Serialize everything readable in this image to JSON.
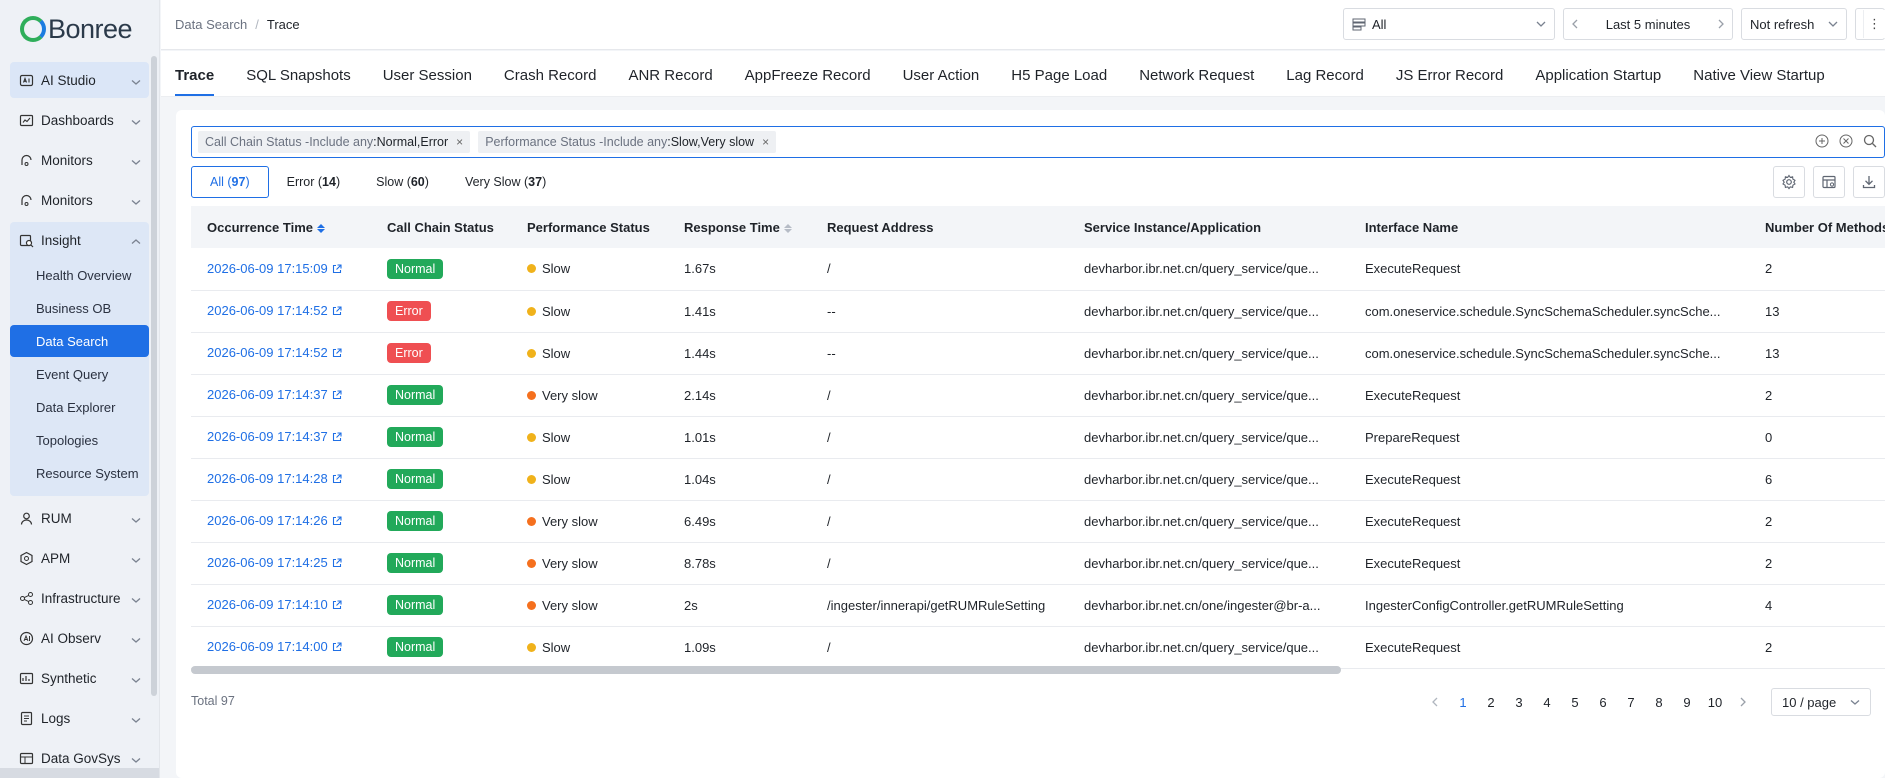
{
  "app": {
    "logo_text": "Bonree"
  },
  "sidebar": {
    "items": [
      {
        "label": "AI Studio",
        "icon": "ai-studio-icon",
        "highlighted": true
      },
      {
        "label": "Dashboards",
        "icon": "dashboard-icon"
      },
      {
        "label": "Monitors",
        "icon": "monitor-icon"
      },
      {
        "label": "Monitors",
        "icon": "monitor-icon"
      }
    ],
    "insight": {
      "label": "Insight",
      "icon": "insight-icon",
      "children": [
        "Health Overview",
        "Business OB",
        "Data Search",
        "Event Query",
        "Data Explorer",
        "Topologies",
        "Resource System"
      ],
      "active_child": "Data Search"
    },
    "items_after": [
      {
        "label": "RUM",
        "icon": "rum-icon"
      },
      {
        "label": "APM",
        "icon": "apm-icon"
      },
      {
        "label": "Infrastructure",
        "icon": "infrastructure-icon"
      },
      {
        "label": "AI Observ",
        "icon": "ai-observ-icon"
      },
      {
        "label": "Synthetic",
        "icon": "synthetic-icon"
      },
      {
        "label": "Logs",
        "icon": "logs-icon"
      },
      {
        "label": "Data GovSys",
        "icon": "data-gov-icon"
      }
    ]
  },
  "header": {
    "breadcrumb": [
      "Data Search",
      "Trace"
    ],
    "scope_select": "All",
    "time_range": "Last 5 minutes",
    "refresh_select": "Not refresh"
  },
  "tabs": [
    "Trace",
    "SQL Snapshots",
    "User Session",
    "Crash Record",
    "ANR Record",
    "AppFreeze Record",
    "User Action",
    "H5 Page Load",
    "Network Request",
    "Lag Record",
    "JS Error Record",
    "Application Startup",
    "Native View Startup"
  ],
  "active_tab": "Trace",
  "filters": [
    {
      "key": "Call Chain Status -Include any ",
      "value": ":Normal,Error"
    },
    {
      "key": "Performance Status -Include any ",
      "value": ":Slow,Very slow"
    }
  ],
  "segments": [
    {
      "label": "All",
      "count": "97",
      "active": true
    },
    {
      "label": "Error",
      "count": "14"
    },
    {
      "label": "Slow",
      "count": "60"
    },
    {
      "label": "Very Slow",
      "count": "37"
    }
  ],
  "table": {
    "columns": [
      "Occurrence Time",
      "Call Chain Status",
      "Performance Status",
      "Response Time",
      "Request Address",
      "Service Instance/Application",
      "Interface Name",
      "Number Of Methods"
    ],
    "rows": [
      {
        "time": "2026-06-09 17:15:09",
        "status": "Normal",
        "perf": "Slow",
        "resp": "1.67s",
        "addr": "/",
        "service": "devharbor.ibr.net.cn/query_service/que...",
        "iface": "ExecuteRequest",
        "methods": "2"
      },
      {
        "time": "2026-06-09 17:14:52",
        "status": "Error",
        "perf": "Slow",
        "resp": "1.41s",
        "addr": "--",
        "service": "devharbor.ibr.net.cn/query_service/que...",
        "iface": "com.oneservice.schedule.SyncSchemaScheduler.syncSche...",
        "methods": "13"
      },
      {
        "time": "2026-06-09 17:14:52",
        "status": "Error",
        "perf": "Slow",
        "resp": "1.44s",
        "addr": "--",
        "service": "devharbor.ibr.net.cn/query_service/que...",
        "iface": "com.oneservice.schedule.SyncSchemaScheduler.syncSche...",
        "methods": "13"
      },
      {
        "time": "2026-06-09 17:14:37",
        "status": "Normal",
        "perf": "Very slow",
        "resp": "2.14s",
        "addr": "/",
        "service": "devharbor.ibr.net.cn/query_service/que...",
        "iface": "ExecuteRequest",
        "methods": "2"
      },
      {
        "time": "2026-06-09 17:14:37",
        "status": "Normal",
        "perf": "Slow",
        "resp": "1.01s",
        "addr": "/",
        "service": "devharbor.ibr.net.cn/query_service/que...",
        "iface": "PrepareRequest",
        "methods": "0"
      },
      {
        "time": "2026-06-09 17:14:28",
        "status": "Normal",
        "perf": "Slow",
        "resp": "1.04s",
        "addr": "/",
        "service": "devharbor.ibr.net.cn/query_service/que...",
        "iface": "ExecuteRequest",
        "methods": "6"
      },
      {
        "time": "2026-06-09 17:14:26",
        "status": "Normal",
        "perf": "Very slow",
        "resp": "6.49s",
        "addr": "/",
        "service": "devharbor.ibr.net.cn/query_service/que...",
        "iface": "ExecuteRequest",
        "methods": "2"
      },
      {
        "time": "2026-06-09 17:14:25",
        "status": "Normal",
        "perf": "Very slow",
        "resp": "8.78s",
        "addr": "/",
        "service": "devharbor.ibr.net.cn/query_service/que...",
        "iface": "ExecuteRequest",
        "methods": "2"
      },
      {
        "time": "2026-06-09 17:14:10",
        "status": "Normal",
        "perf": "Very slow",
        "resp": "2s",
        "addr": "/ingester/innerapi/getRUMRuleSetting",
        "service": "devharbor.ibr.net.cn/one/ingester@br-a...",
        "iface": "IngesterConfigController.getRUMRuleSetting",
        "methods": "4"
      },
      {
        "time": "2026-06-09 17:14:00",
        "status": "Normal",
        "perf": "Slow",
        "resp": "1.09s",
        "addr": "/",
        "service": "devharbor.ibr.net.cn/query_service/que...",
        "iface": "ExecuteRequest",
        "methods": "2"
      }
    ]
  },
  "footer": {
    "total": "Total 97",
    "pages": [
      "1",
      "2",
      "3",
      "4",
      "5",
      "6",
      "7",
      "8",
      "9",
      "10"
    ],
    "current_page": "1",
    "page_size": "10 / page"
  },
  "colors": {
    "accent": "#1f6fe5",
    "normal": "#22a95a",
    "error": "#ef4f52",
    "slow": "#f0b21b",
    "very_slow": "#f5701e"
  }
}
